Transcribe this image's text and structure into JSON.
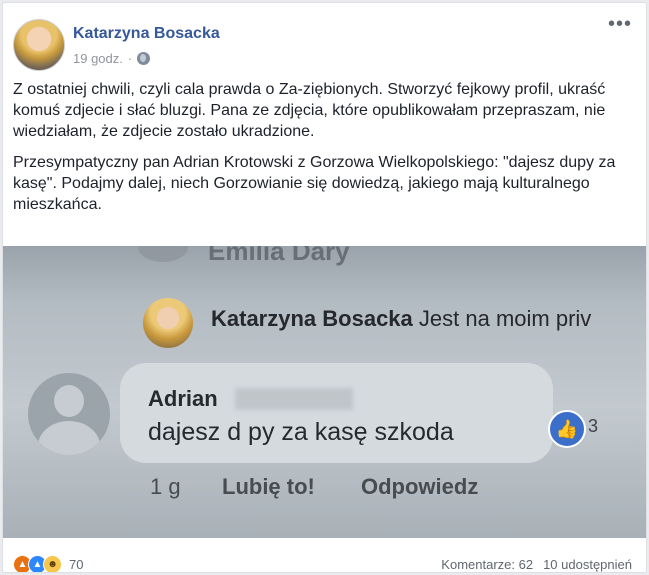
{
  "post": {
    "author": "Katarzyna Bosacka",
    "time": "19 godz.",
    "more_label": "•••",
    "paragraphs": [
      "Z ostatniej chwili, czyli cala prawda o Za-ziębionych. Stworzyć fejkowy profil, ukraść komuś zdjecie i słać bluzgi. Pana ze zdjęcia, które opublikowałam przepraszam, nie wiedziałam, że zdjecie zostało ukradzione.",
      "Przesympatyczny pan Adrian Krotowski z Gorzowa Wielkopolskiego: \"dajesz dupy za kasę\". Podajmy dalej, niech Gorzowianie się dowiedzą, jakiego mają kulturalnego mieszkańca."
    ]
  },
  "photo": {
    "partial_name_top": "Emilia Dary",
    "kb_name": "Katarzyna Bosacka",
    "kb_text": "Jest na moim priv",
    "commenter": "Adrian",
    "comment": "dajesz d  py za kasę szkoda",
    "like_count": "3",
    "ago": "1 g",
    "like_action": "Lubię to!",
    "reply_action": "Odpowiedz"
  },
  "footer": {
    "reaction_icons": [
      "angry-icon",
      "like-icon",
      "haha-icon"
    ],
    "reaction_count": "70",
    "comments": "Komentarze: 62",
    "shares": "10 udostępnień"
  }
}
